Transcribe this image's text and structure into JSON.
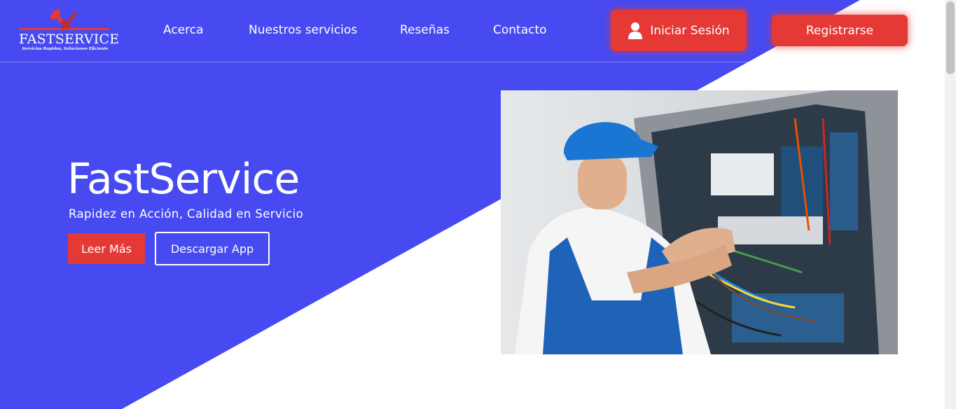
{
  "brand": {
    "name": "FASTSERVICE",
    "slogan": "Servicios Rapidos, Soluciones Eficiente"
  },
  "nav": {
    "links": [
      "Acerca",
      "Nuestros servicios",
      "Reseñas",
      "Contacto"
    ],
    "login_label": "Iniciar Sesión",
    "register_label": "Registrarse"
  },
  "hero": {
    "title": "FastService",
    "subtitle": "Rapidez en Acción, Calidad en Servicio",
    "read_more_label": "Leer Más",
    "download_label": "Descargar App",
    "image_icon": "electrician-photo"
  },
  "colors": {
    "primary": "#474af0",
    "accent": "#e53935",
    "background": "#ffffff"
  }
}
